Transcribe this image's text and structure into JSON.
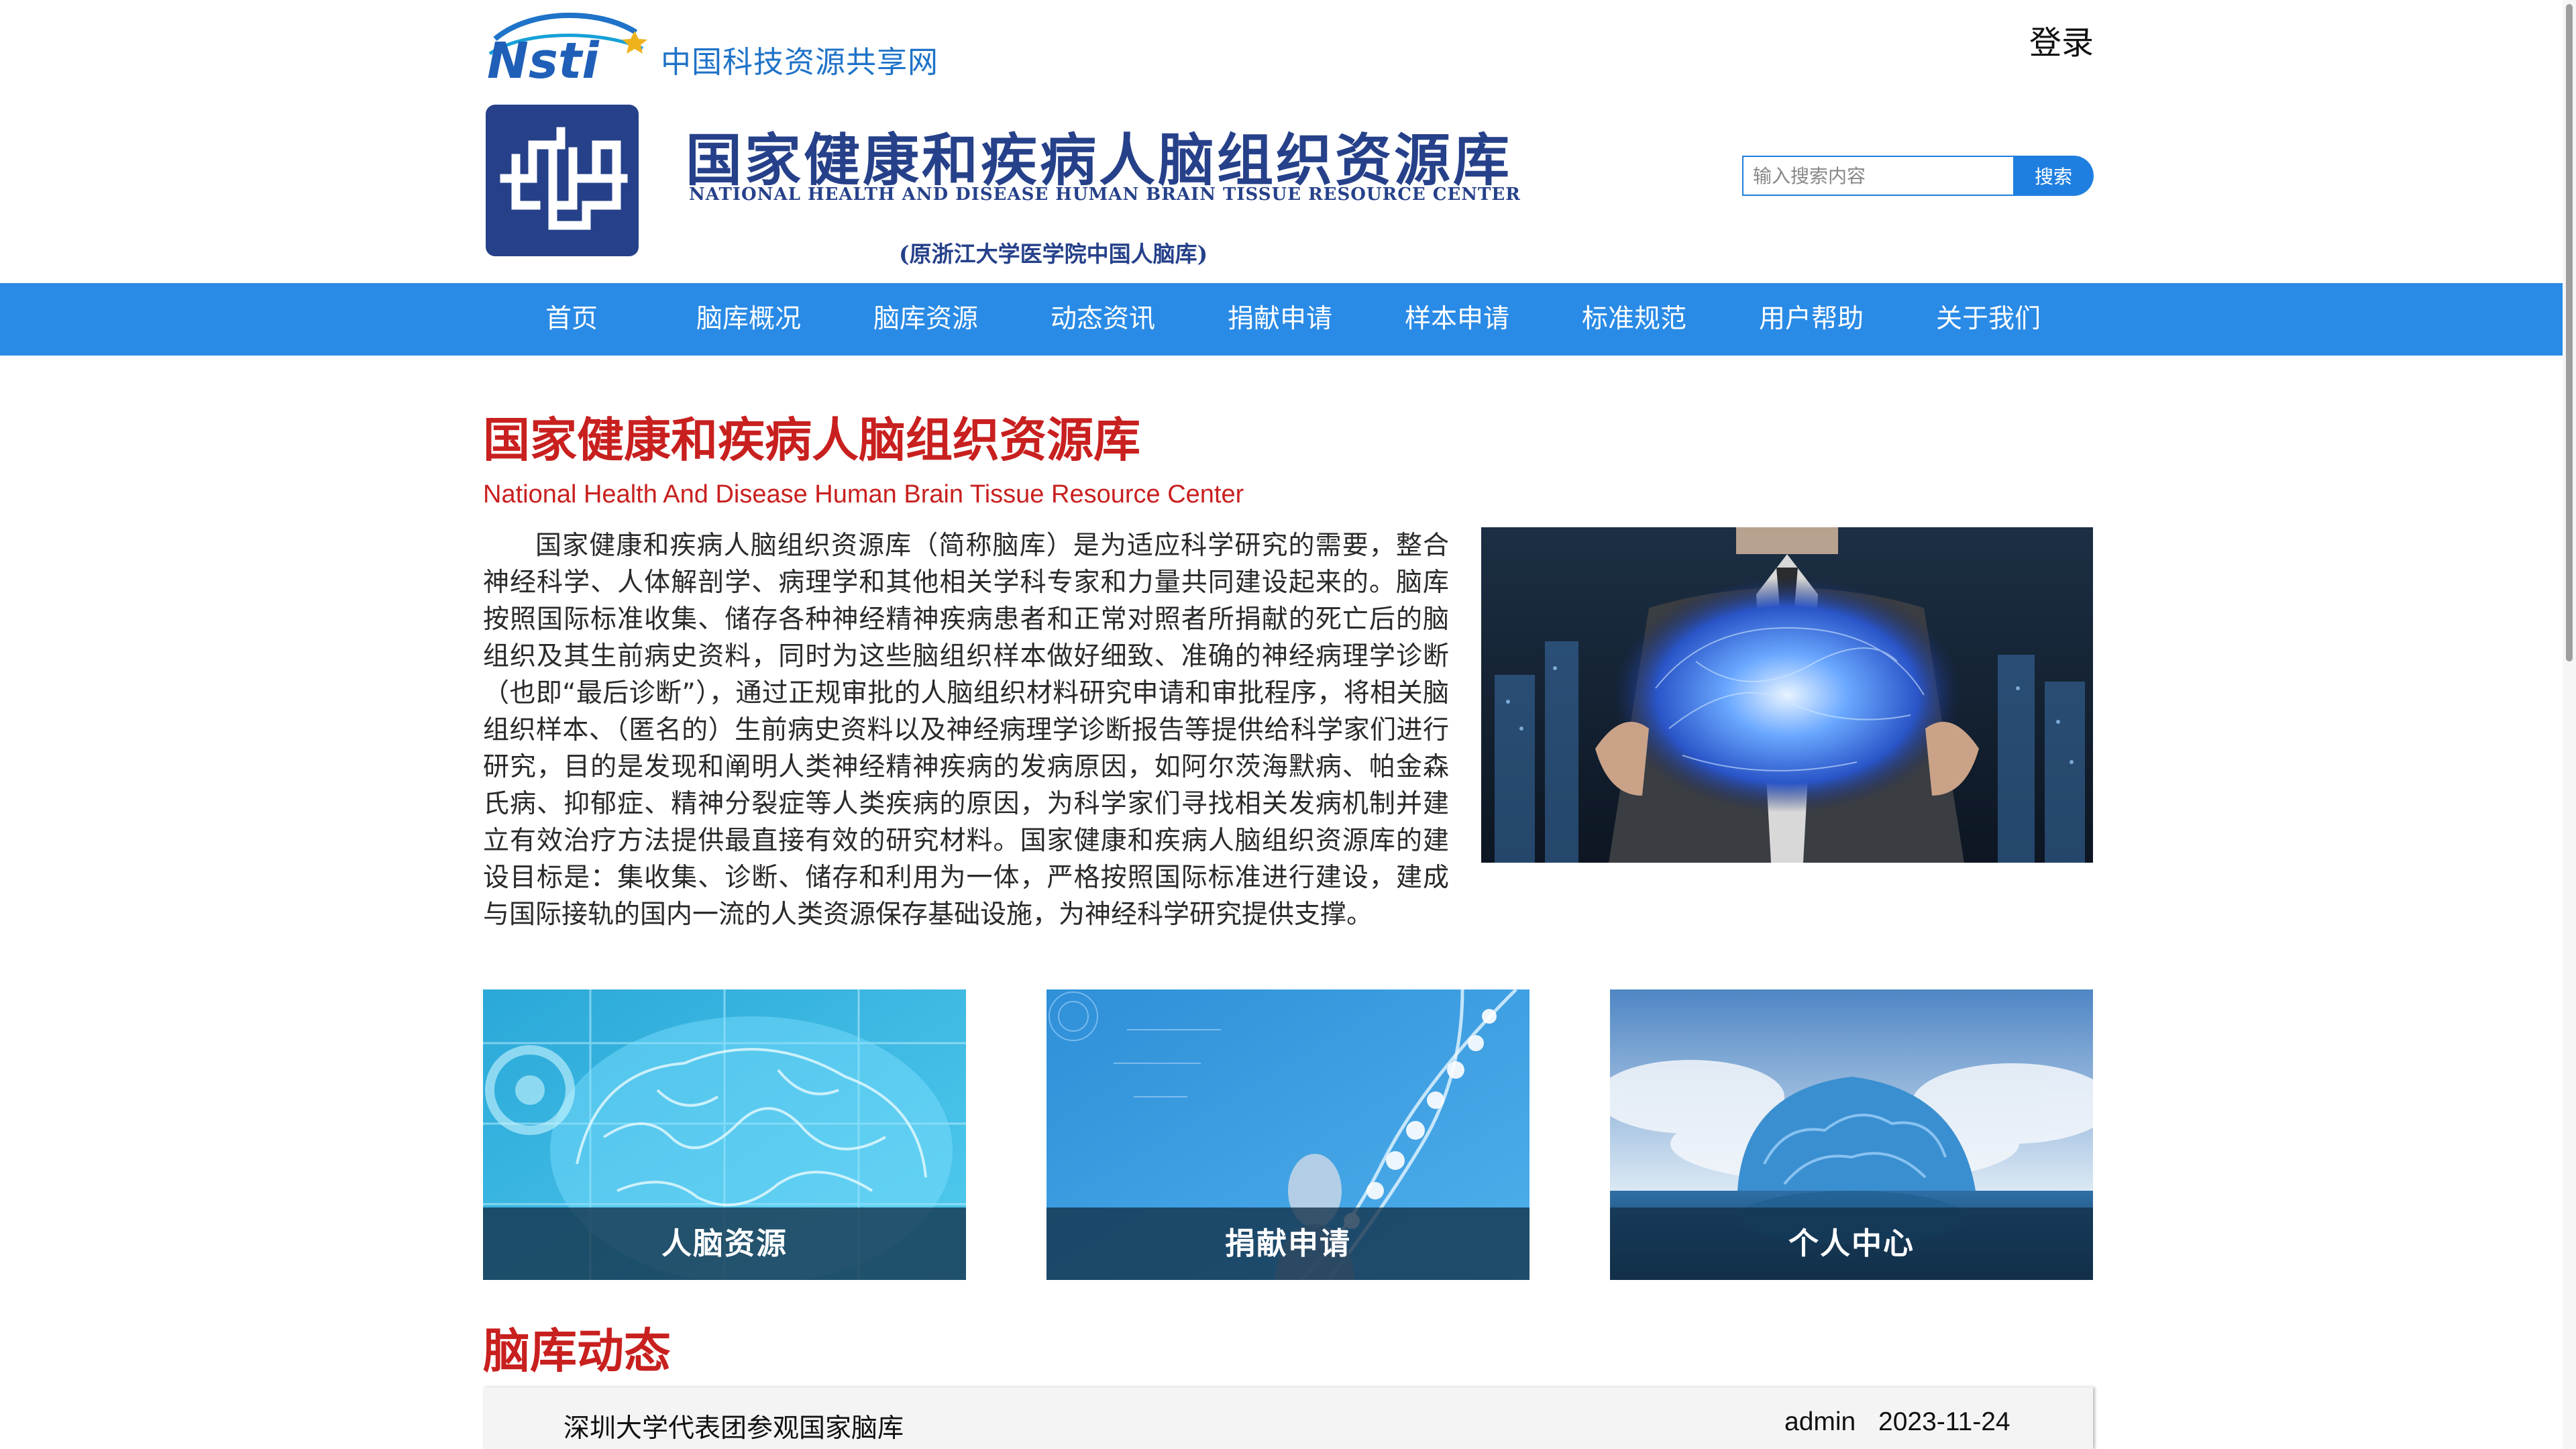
{
  "site": {
    "portal_name": "中国科技资源共享网",
    "login_label": "登录"
  },
  "banner": {
    "title": "国家健康和疾病人脑组织资源库",
    "title_en": "NATIONAL HEALTH AND DISEASE HUMAN BRAIN TISSUE RESOURCE CENTER",
    "subtitle": "(原浙江大学医学院中国人脑库)"
  },
  "search": {
    "placeholder": "输入搜索内容",
    "button_label": "搜索"
  },
  "nav": {
    "items": [
      {
        "label": "首页"
      },
      {
        "label": "脑库概况"
      },
      {
        "label": "脑库资源"
      },
      {
        "label": "动态资讯"
      },
      {
        "label": "捐献申请"
      },
      {
        "label": "样本申请"
      },
      {
        "label": "标准规范"
      },
      {
        "label": "用户帮助"
      },
      {
        "label": "关于我们"
      }
    ]
  },
  "intro": {
    "title": "国家健康和疾病人脑组织资源库",
    "subtitle": "National Health And Disease Human Brain Tissue Resource Center",
    "body": "国家健康和疾病人脑组织资源库（简称脑库）是为适应科学研究的需要，整合神经科学、人体解剖学、病理学和其他相关学科专家和力量共同建设起来的。脑库按照国际标准收集、储存各种神经精神疾病患者和正常对照者所捐献的死亡后的脑组织及其生前病史资料，同时为这些脑组织样本做好细致、准确的神经病理学诊断（也即“最后诊断”），通过正规审批的人脑组织材料研究申请和审批程序，将相关脑组织样本、（匿名的）生前病史资料以及神经病理学诊断报告等提供给科学家们进行研究，目的是发现和阐明人类神经精神疾病的发病原因，如阿尔茨海默病、帕金森氏病、抑郁症、精神分裂症等人类疾病的原因，为科学家们寻找相关发病机制并建立有效治疗方法提供最直接有效的研究材料。国家健康和疾病人脑组织资源库的建设目标是：集收集、诊断、储存和利用为一体，严格按照国际标准进行建设，建成与国际接轨的国内一流的人类资源保存基础设施，为神经科学研究提供支撑。"
  },
  "cards": [
    {
      "label": "人脑资源"
    },
    {
      "label": "捐献申请"
    },
    {
      "label": "个人中心"
    }
  ],
  "news": {
    "heading": "脑库动态",
    "items": [
      {
        "title": "深圳大学代表团参观国家脑库",
        "author": "admin",
        "date": "2023-11-24"
      }
    ]
  },
  "colors": {
    "nav_bg": "#2a8be6",
    "accent_red": "#c8201f",
    "brand_navy": "#26418a",
    "search_blue": "#1f7fe0"
  }
}
